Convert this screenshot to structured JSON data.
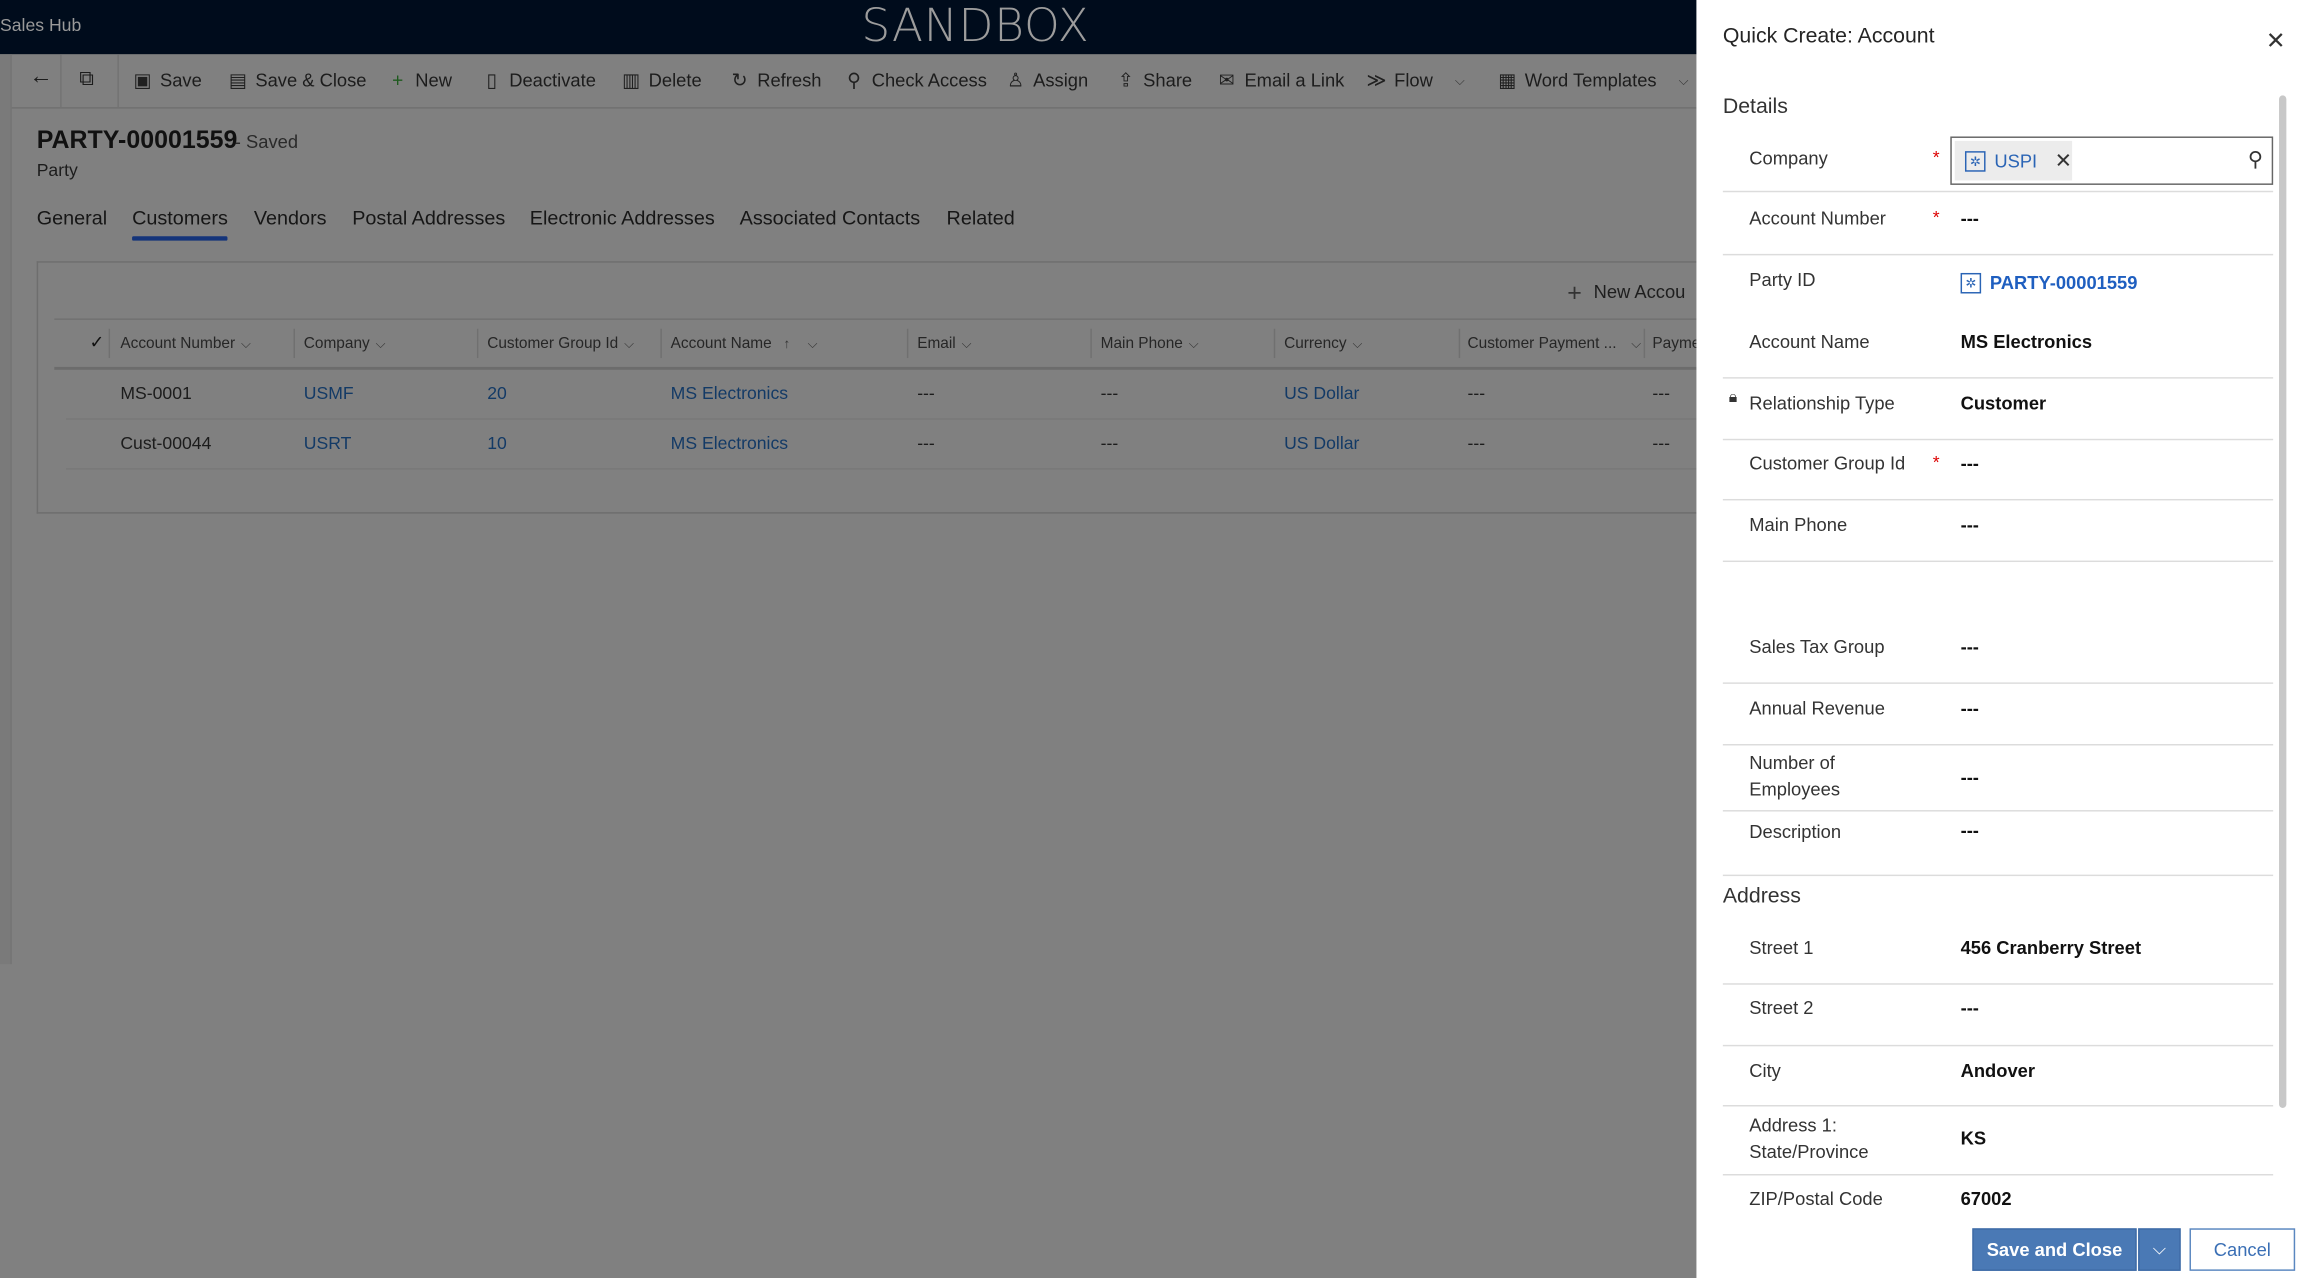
{
  "app": {
    "title": "Sales Hub",
    "environment": "SANDBOX"
  },
  "toolbar": {
    "items": [
      {
        "label": "Save",
        "icon": "save-icon"
      },
      {
        "label": "Save & Close",
        "icon": "save-close-icon"
      },
      {
        "label": "New",
        "icon": "plus-icon"
      },
      {
        "label": "Deactivate",
        "icon": "deactivate-icon"
      },
      {
        "label": "Delete",
        "icon": "trash-icon"
      },
      {
        "label": "Refresh",
        "icon": "refresh-icon"
      },
      {
        "label": "Check Access",
        "icon": "key-icon"
      },
      {
        "label": "Assign",
        "icon": "person-icon"
      },
      {
        "label": "Share",
        "icon": "share-icon"
      },
      {
        "label": "Email a Link",
        "icon": "email-icon"
      },
      {
        "label": "Flow",
        "icon": "flow-icon"
      },
      {
        "label": "Word Templates",
        "icon": "word-icon"
      }
    ]
  },
  "record": {
    "title": "PARTY-00001559",
    "status": "- Saved",
    "type": "Party"
  },
  "tabs": [
    {
      "label": "General",
      "active": false
    },
    {
      "label": "Customers",
      "active": true
    },
    {
      "label": "Vendors",
      "active": false
    },
    {
      "label": "Postal Addresses",
      "active": false
    },
    {
      "label": "Electronic Addresses",
      "active": false
    },
    {
      "label": "Associated Contacts",
      "active": false
    },
    {
      "label": "Related",
      "active": false
    }
  ],
  "grid": {
    "new_label": "New Accou",
    "columns": [
      "Account Number",
      "Company",
      "Customer Group Id",
      "Account Name",
      "Email",
      "Main Phone",
      "Currency",
      "Customer Payment ...",
      "Payme"
    ],
    "sort_column": "Account Name",
    "rows": [
      [
        "MS-0001",
        "USMF",
        "20",
        "MS Electronics",
        "---",
        "---",
        "US Dollar",
        "---",
        "---"
      ],
      [
        "Cust-00044",
        "USRT",
        "10",
        "MS Electronics",
        "---",
        "---",
        "US Dollar",
        "---",
        "---"
      ]
    ]
  },
  "panel": {
    "title": "Quick Create: Account",
    "details_heading": "Details",
    "address_heading": "Address",
    "company": {
      "label": "Company",
      "value": "USPI",
      "required": true
    },
    "party": {
      "label": "Party ID",
      "value": "PARTY-00001559"
    },
    "fields": [
      {
        "label": "Account Number",
        "value": "---",
        "required": true
      },
      {
        "label": "Account Name",
        "value": "MS Electronics"
      },
      {
        "label": "Relationship Type",
        "value": "Customer",
        "locked": true
      },
      {
        "label": "Customer Group Id",
        "value": "---",
        "required": true
      },
      {
        "label": "Main Phone",
        "value": "---"
      },
      {
        "label": "Sales Tax Group",
        "value": "---"
      },
      {
        "label": "Annual Revenue",
        "value": "---"
      },
      {
        "label": "Number of Employees",
        "value": "---"
      },
      {
        "label": "Description",
        "value": "---"
      },
      {
        "label": "Street 1",
        "value": "456 Cranberry Street"
      },
      {
        "label": "Street 2",
        "value": "---"
      },
      {
        "label": "City",
        "value": "Andover"
      },
      {
        "label": "Address 1: State/Province",
        "value": "KS"
      },
      {
        "label": "ZIP/Postal Code",
        "value": "67002"
      }
    ],
    "save_label": "Save and Close",
    "cancel_label": "Cancel"
  },
  "colors": {
    "accent": "#4a79b5",
    "link": "#1f5fc0",
    "required": "#dd0000",
    "topbar": "#000c1c"
  }
}
